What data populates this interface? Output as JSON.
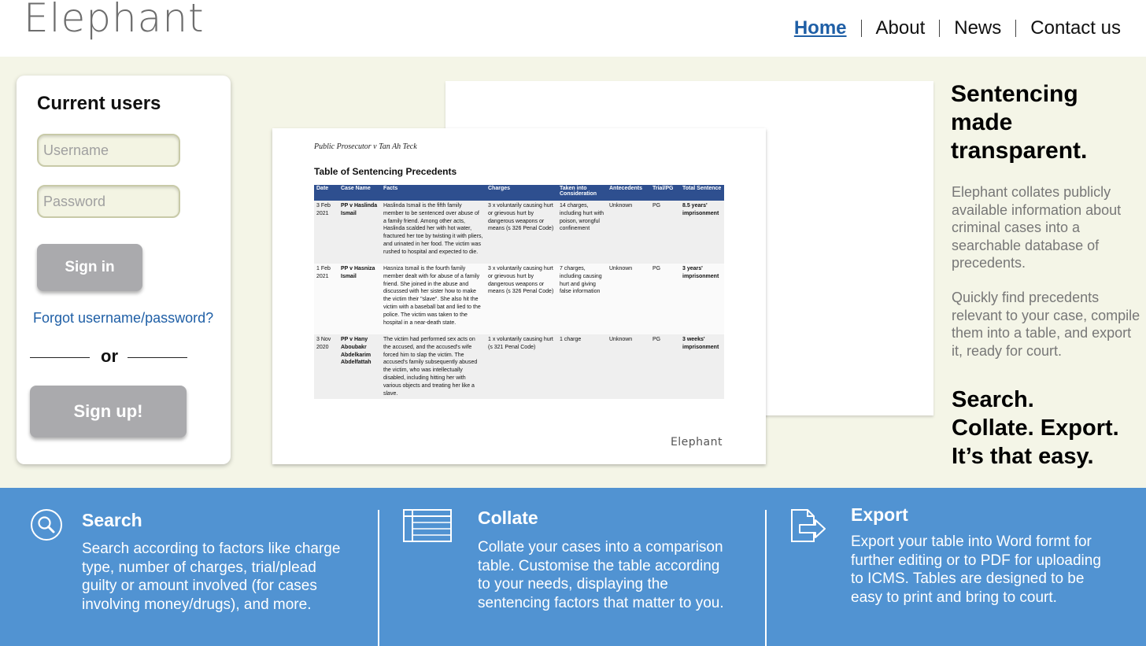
{
  "header": {
    "logo": "Elephant",
    "nav": [
      "Home",
      "About",
      "News",
      "Contact us"
    ]
  },
  "login": {
    "title": "Current users",
    "username_placeholder": "Username",
    "password_placeholder": "Password",
    "signin_label": "Sign in",
    "forgot_label": "Forgot username/password?",
    "or_label": "or",
    "signup_label": "Sign up!"
  },
  "preview": {
    "case_title": "Public Prosecutor v Tan Ah Teck",
    "table_title": "Table of Sentencing Precedents",
    "columns": [
      "Date",
      "Case Name",
      "Facts",
      "Charges",
      "Taken into Consideration",
      "Antecedents",
      "Trial/PG",
      "Total Sentence"
    ],
    "rows": [
      [
        "3 Feb 2021",
        "PP v Haslinda Ismail",
        "Haslinda Ismail is the fifth family member to be sentenced over abuse of a family friend. Among other acts, Haslinda scalded her with hot water, fractured her toe by twisting it with pliers, and urinated in her food. The victim was rushed to hospital and expected to die.",
        "3 x voluntarily causing hurt or grievous hurt by dangerous weapons or means (s 326 Penal Code)",
        "14 charges, including hurt with poison, wrongful confinement",
        "Unknown",
        "PG",
        "8.5 years' imprisonment"
      ],
      [
        "1 Feb 2021",
        "PP v Hasniza Ismail",
        "Hasniza Ismail is the fourth family member dealt with for abuse of a family friend. She joined in the abuse and discussed with her sister how to make the victim their \"slave\". She also hit the victim with a baseball bat and lied to the police. The victim was taken to the hospital in a near-death state.",
        "3 x voluntarily causing hurt or grievous hurt by dangerous weapons or means (s 326 Penal Code)",
        "7 charges, including causing hurt and giving false information",
        "Unknown",
        "PG",
        "3 years' imprisonment"
      ],
      [
        "3 Nov 2020",
        "PP v Hany Aboubakr Abdelkarim Abdelfattah",
        "The victim had performed sex acts on the accused, and the accused's wife forced him to slap the victim. The accused's family subsequently abused the victim, who was intellectually disabled, including hitting her with various objects and treating her like a slave.",
        "1 x voluntarily causing hurt (s 321 Penal Code)",
        "1 charge",
        "Unknown",
        "PG",
        "3 weeks' imprisonment"
      ]
    ],
    "doc_logo": "Elephant"
  },
  "intro": {
    "tagline": [
      "Sentencing",
      "made",
      "transparent."
    ],
    "desc1": "Elephant collates publicly available information about criminal cases into a searchable database of precedents.",
    "desc2": "Quickly find precedents relevant to your case, compile them into a table, and export it, ready for court.",
    "slogan": [
      "Search.",
      "Collate. Export.",
      "It’s that easy."
    ]
  },
  "features": [
    {
      "icon": "search-icon",
      "title": "Search",
      "text": "Search according to factors like charge type, number of charges, trial/plead guilty or amount involved (for cases involving money/drugs), and more."
    },
    {
      "icon": "table-icon",
      "title": "Collate",
      "text": "Collate your cases into a comparison table. Customise the table according to your needs, displaying the sentencing factors that matter to you."
    },
    {
      "icon": "export-icon",
      "title": "Export",
      "text": "Export your table into Word formt for further editing or to PDF for uploading to ICMS. Tables are designed to be easy to print and bring to court."
    }
  ],
  "colors": {
    "accent_blue": "#5193d2",
    "link_blue": "#1f5fa6",
    "hero_bg": "#f4f5e7",
    "button_gray": "#aaaaad"
  }
}
